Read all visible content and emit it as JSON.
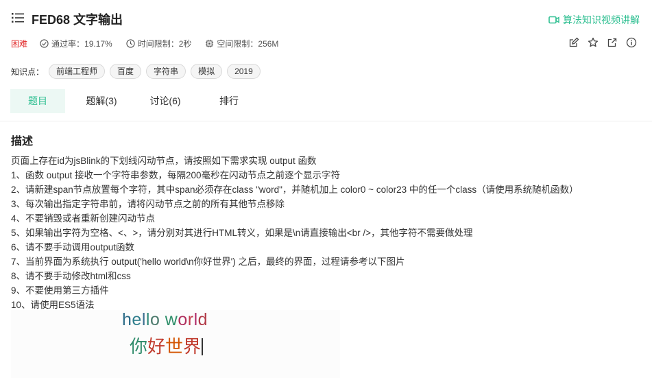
{
  "header": {
    "title": "FED68  文字输出",
    "video_link": "算法知识视频讲解"
  },
  "meta": {
    "difficulty": "困难",
    "pass_rate": "通过率：19.17%",
    "time_limit": "时间限制：2秒",
    "memory_limit": "空间限制：256M"
  },
  "tags": {
    "label": "知识点：",
    "items": [
      "前端工程师",
      "百度",
      "字符串",
      "模拟",
      "2019"
    ]
  },
  "tabs": [
    "题目",
    "题解(3)",
    "讨论(6)",
    "排行"
  ],
  "description": {
    "heading": "描述",
    "lines": [
      "页面上存在id为jsBlink的下划线闪动节点，请按照如下需求实现 output 函数",
      "1、函数 output 接收一个字符串参数，每隔200毫秒在闪动节点之前逐个显示字符",
      "2、请新建span节点放置每个字符，其中span必须存在class \"word\"，并随机加上 color0 ~ color23 中的任一个class（请使用系统随机函数）",
      "3、每次输出指定字符串前，请将闪动节点之前的所有其他节点移除",
      "4、不要销毁或者重新创建闪动节点",
      "5、如果输出字符为空格、<、>，请分别对其进行HTML转义，如果是\\n请直接输出<br />，其他字符不需要做处理",
      "6、请不要手动调用output函数",
      "7、当前界面为系统执行 output('hello world\\n你好世界') 之后，最终的界面，过程请参考以下图片",
      "8、请不要手动修改html和css",
      "9、不要使用第三方插件",
      "10、请使用ES5语法"
    ]
  },
  "demo": {
    "line1": [
      {
        "ch": "h",
        "color": "#2b6a87"
      },
      {
        "ch": "e",
        "color": "#2e7d8c"
      },
      {
        "ch": "l",
        "color": "#3b6f8f"
      },
      {
        "ch": "l",
        "color": "#2f8a7a"
      },
      {
        "ch": "o",
        "color": "#4b7a6c"
      },
      {
        "ch": " ",
        "color": "#333333"
      },
      {
        "ch": "w",
        "color": "#2f8f6a"
      },
      {
        "ch": "o",
        "color": "#b0305e"
      },
      {
        "ch": "r",
        "color": "#c23a4c"
      },
      {
        "ch": "l",
        "color": "#b02d6a"
      },
      {
        "ch": "d",
        "color": "#b23a48"
      }
    ],
    "line2": [
      {
        "ch": "你",
        "color": "#2e8b6a"
      },
      {
        "ch": "好",
        "color": "#c0392b"
      },
      {
        "ch": "世",
        "color": "#d35400"
      },
      {
        "ch": "界",
        "color": "#c0392b"
      }
    ]
  },
  "colors": {
    "accent": "#2ebf91",
    "difficulty_red": "#e02424"
  }
}
